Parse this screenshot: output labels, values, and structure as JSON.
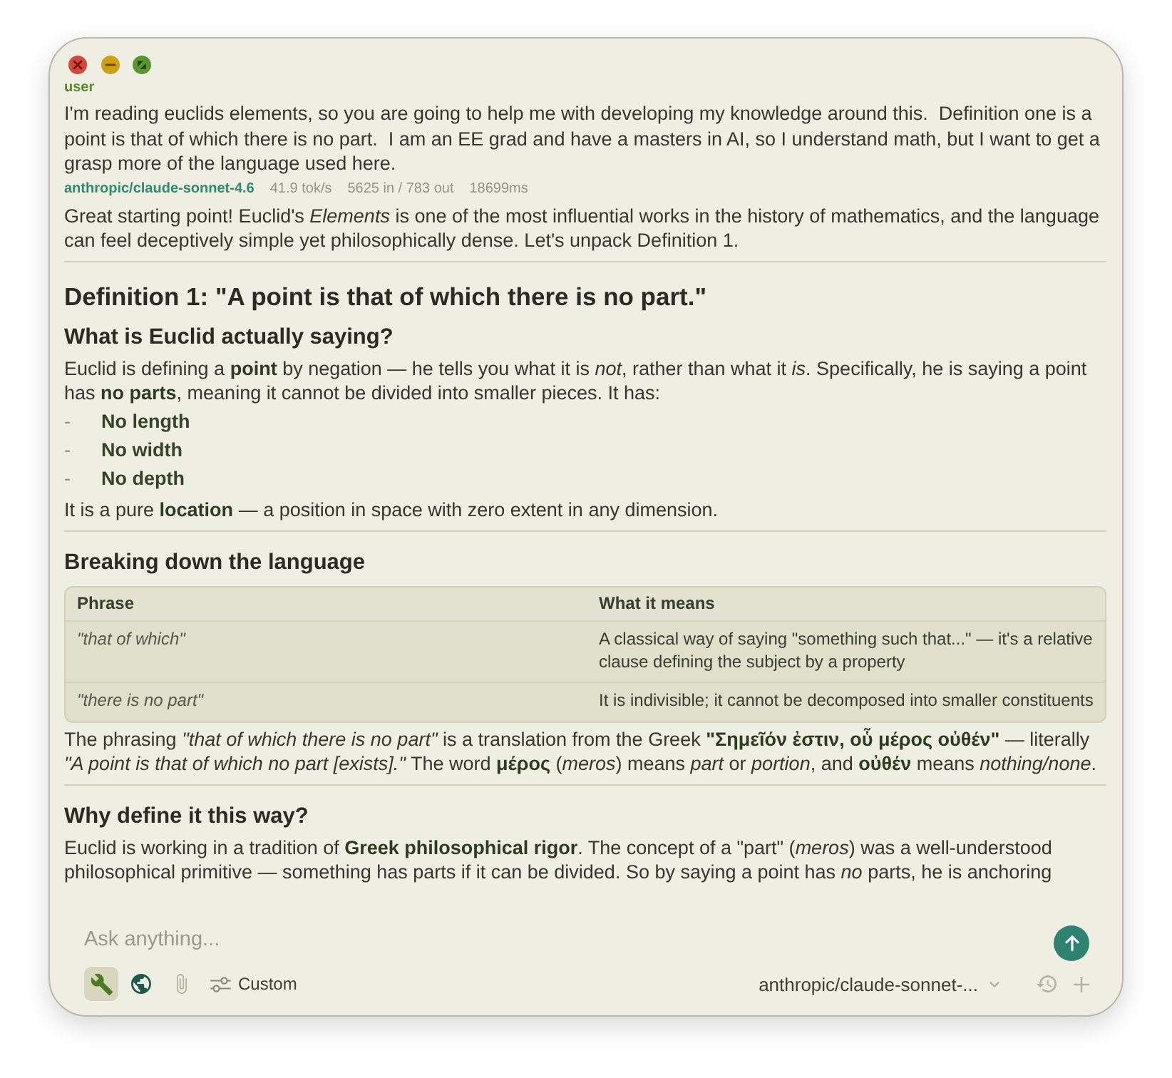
{
  "messages": [
    {
      "kind": "user",
      "role_label": "user",
      "text": "I'm reading euclids elements, so you are going to help me with developing my knowledge around this.  Definition one is a point is that of which there is no part.  I am an EE grad and have a masters in AI, so I understand math, but I want to get a grasp more of the language used here."
    },
    {
      "kind": "assistant",
      "meta": {
        "model": "anthropic/claude-sonnet-4.6",
        "speed": "41.9 tok/s",
        "tokens": "5625 in / 783 out",
        "duration": "18699ms"
      },
      "blocks": [
        {
          "kind": "paragraph",
          "text": "Great starting point! Euclid's *Elements* is one of the most influential works in the history of mathematics, and the language can feel deceptively simple yet philosophically dense. Let's unpack Definition 1."
        },
        {
          "kind": "divider"
        },
        {
          "kind": "heading1",
          "text": "Definition 1: \"A point is that of which there is no part.\""
        },
        {
          "kind": "heading2",
          "text": "What is Euclid actually saying?"
        },
        {
          "kind": "paragraph",
          "text": "Euclid is defining a **point** by negation — he tells you what it is *not*, rather than what it *is*. Specifically, he is saying a point has **no parts**, meaning it cannot be divided into smaller pieces. It has:"
        },
        {
          "kind": "list",
          "bullet": "-",
          "items": [
            "No length",
            "No width",
            "No depth"
          ]
        },
        {
          "kind": "paragraph",
          "text": "It is a pure **location** — a position in space with zero extent in any dimension."
        },
        {
          "kind": "divider"
        },
        {
          "kind": "heading2",
          "text": "Breaking down the language"
        },
        {
          "kind": "table",
          "columns": [
            "Phrase",
            "What it means"
          ],
          "rows": [
            [
              "\"that of which\"",
              "A classical way of saying \"something such that...\" — it's a relative clause defining the subject by a property"
            ],
            [
              "\"there is no part\"",
              "It is indivisible; it cannot be decomposed into smaller constituents"
            ]
          ]
        },
        {
          "kind": "paragraph",
          "text": "The phrasing *\"that of which there is no part\"* is a translation from the Greek **\"Σημεῖόν ἐστιν, οὗ μέρος οὐθέν\"** — literally *\"A point is that of which no part [exists].\"* The word **μέρος** (*meros*) means *part* or *portion*, and **οὐθέν** means *nothing/none*."
        },
        {
          "kind": "divider"
        },
        {
          "kind": "heading2",
          "text": "Why define it this way?"
        },
        {
          "kind": "paragraph",
          "text": "Euclid is working in a tradition of **Greek philosophical rigor**. The concept of a \"part\" (*meros*) was a well-understood philosophical primitive — something has parts if it can be divided. So by saying a point has *no* parts, he is anchoring"
        }
      ]
    }
  ],
  "composer": {
    "placeholder": "Ask anything...",
    "tools": [
      {
        "kind": "tools",
        "selected": true,
        "disabled": false
      },
      {
        "kind": "web",
        "selected": false,
        "disabled": false
      },
      {
        "kind": "attach",
        "selected": false,
        "disabled": true
      }
    ],
    "mode": "Custom",
    "model": "anthropic/claude-sonnet-..."
  }
}
